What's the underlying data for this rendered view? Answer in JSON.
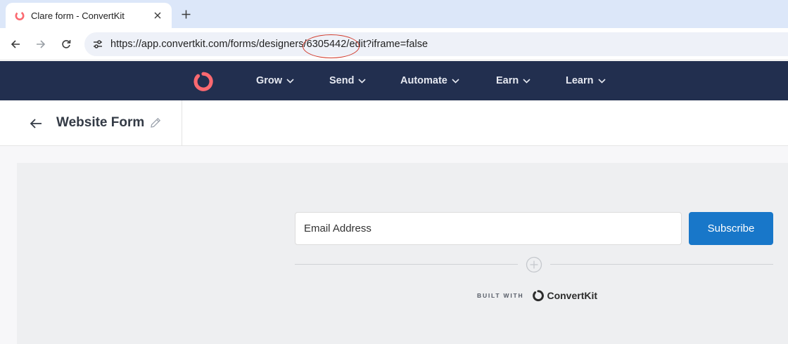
{
  "browser": {
    "tab_title": "Clare form - ConvertKit",
    "url_prefix": "https://app.convertkit.com/forms/designers/",
    "url_highlight": "6305442",
    "url_suffix": "/edit?iframe=false",
    "icons": [
      "favicon-icon",
      "close-icon",
      "plus-icon",
      "back-arrow-icon",
      "forward-arrow-icon",
      "reload-icon",
      "site-settings-icon"
    ]
  },
  "nav": {
    "items": [
      {
        "label": "Grow"
      },
      {
        "label": "Send"
      },
      {
        "label": "Automate"
      },
      {
        "label": "Earn"
      },
      {
        "label": "Learn"
      }
    ],
    "background": "#222f4f",
    "logo_color": "#fb6970"
  },
  "header": {
    "title": "Website Form"
  },
  "form": {
    "email_placeholder": "Email Address",
    "subscribe_label": "Subscribe",
    "accent": "#1877c9"
  },
  "footer": {
    "built_with": "BUILT WITH",
    "brand": "ConvertKit"
  }
}
